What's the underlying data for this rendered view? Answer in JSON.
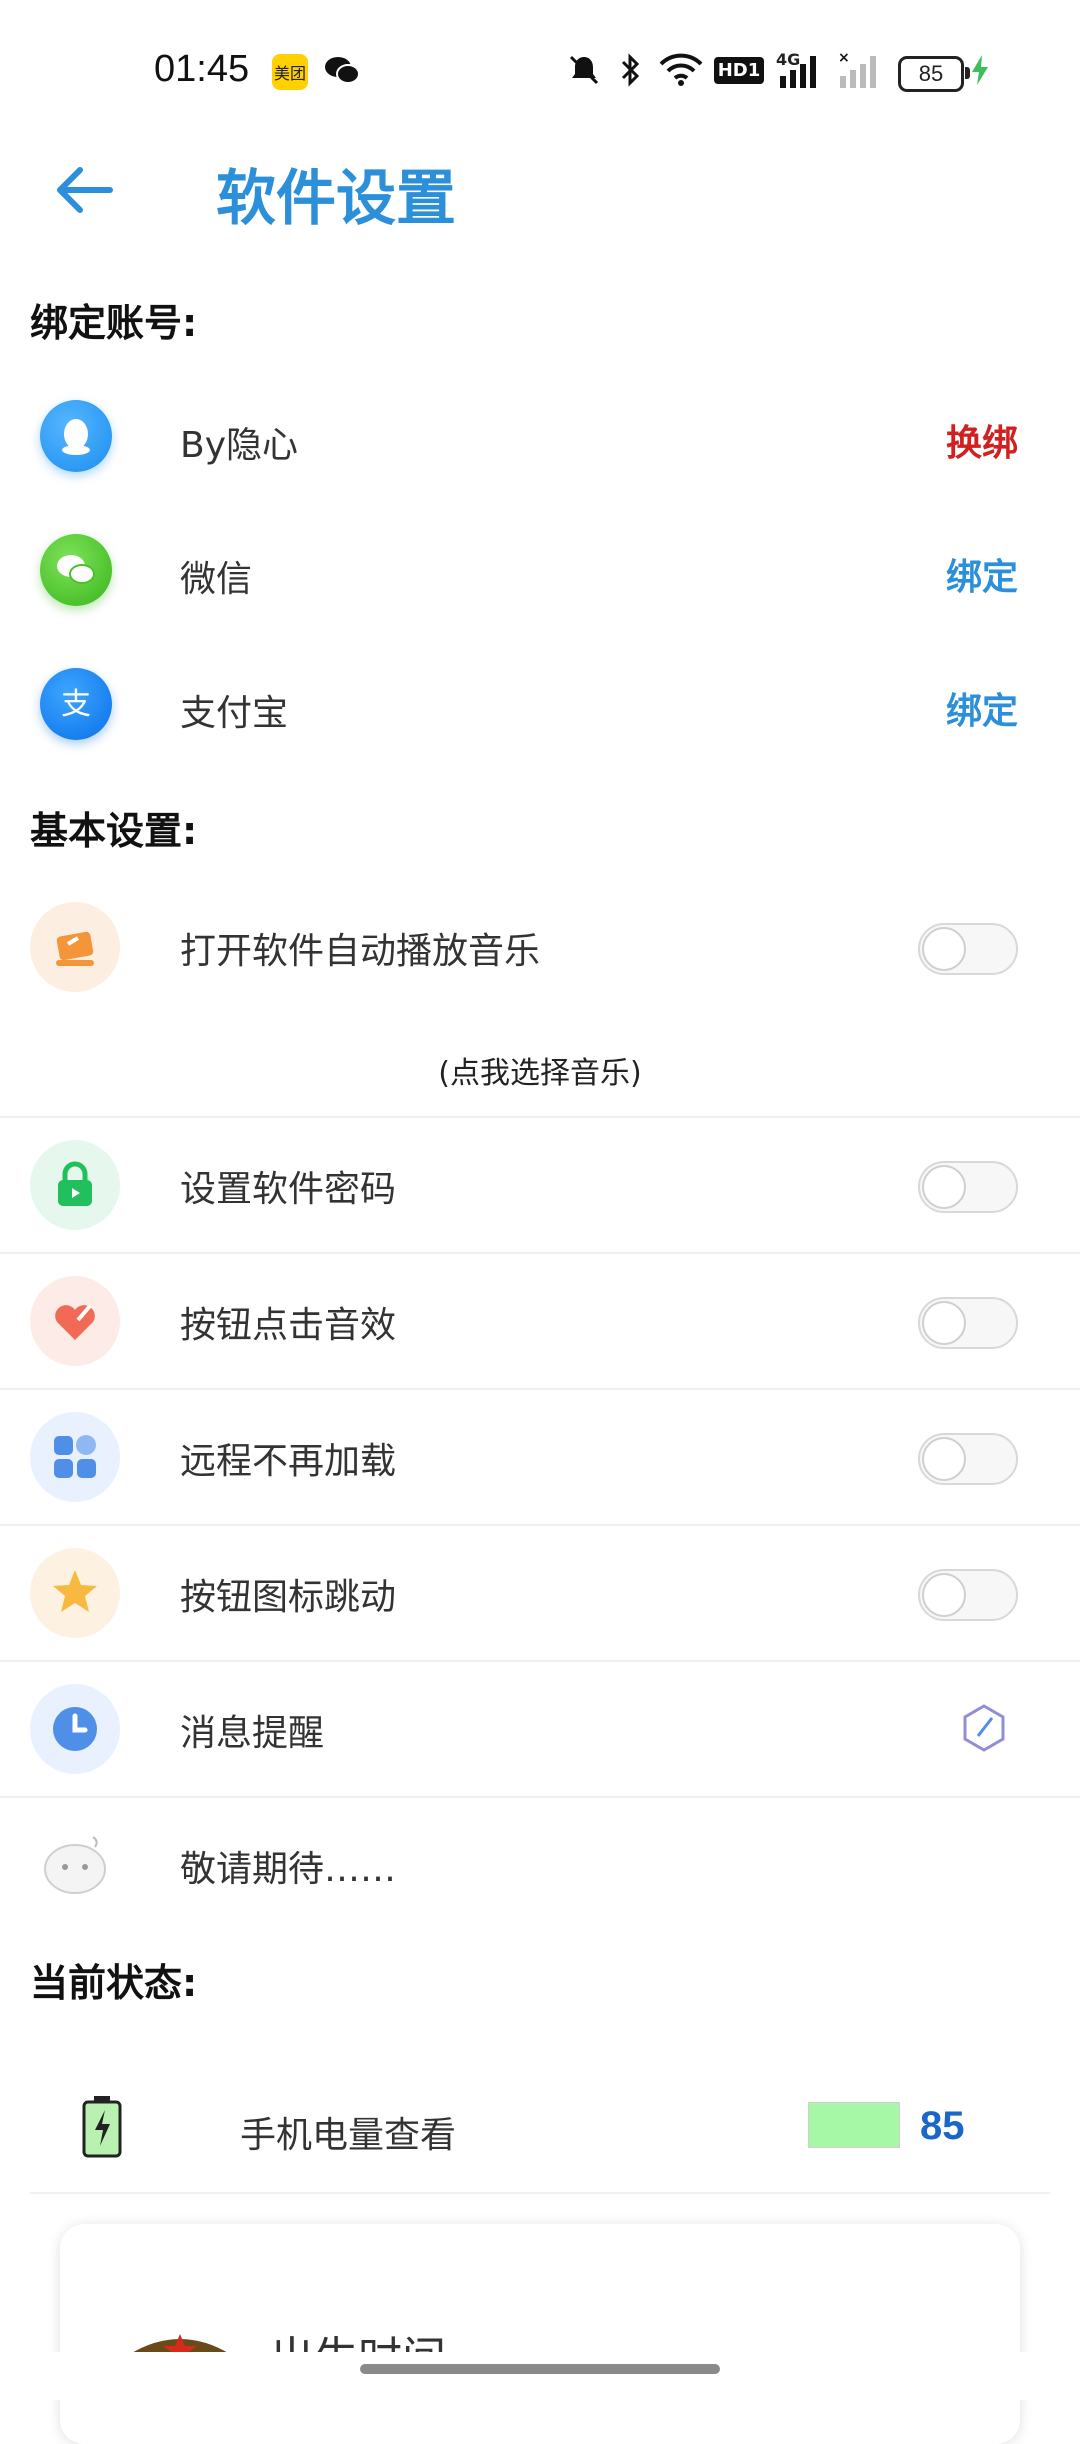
{
  "status_bar": {
    "time": "01:45",
    "meituan_badge": "美团",
    "battery": "85",
    "network": "4G",
    "hd": "HD1",
    "icons": [
      "mute-icon",
      "bluetooth-icon",
      "wifi-icon",
      "hd-icon",
      "signal-icon",
      "signal-off-icon",
      "battery-icon",
      "charging-icon"
    ]
  },
  "header": {
    "title": "软件设置"
  },
  "sections": {
    "bind": "绑定账号:",
    "basic": "基本设置:",
    "status": "当前状态:"
  },
  "accounts": [
    {
      "label": "By隐心",
      "action": "换绑",
      "color": "#d21f1f",
      "icon": "qq-icon"
    },
    {
      "label": "微信",
      "action": "绑定",
      "color": "#2b8fd9",
      "icon": "wechat-icon"
    },
    {
      "label": "支付宝",
      "action": "绑定",
      "color": "#2b8fd9",
      "icon": "alipay-icon"
    }
  ],
  "settings": {
    "music": "打开软件自动播放音乐",
    "music_hint": "(点我选择音乐)",
    "password": "设置软件密码",
    "click_sound": "按钮点击音效",
    "remote": "远程不再加载",
    "icon_jump": "按钮图标跳动",
    "message": "消息提醒",
    "coming": "敬请期待……"
  },
  "battery_status": {
    "label": "手机电量查看",
    "value": "85",
    "bar_color": "#a6f7a6"
  },
  "card": {
    "title": "出生时间"
  },
  "colors": {
    "accent": "#2b8fd9",
    "danger": "#d21f1f"
  }
}
